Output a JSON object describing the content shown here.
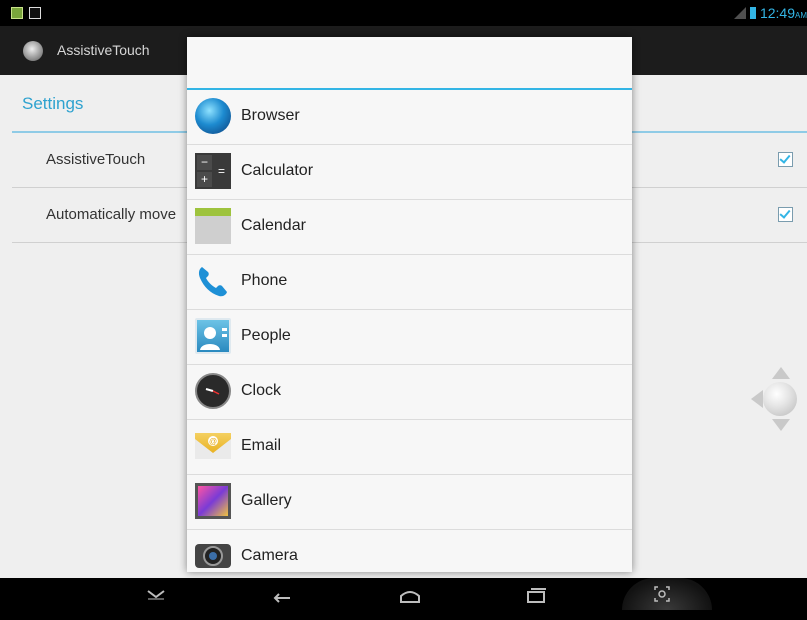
{
  "status_bar": {
    "clock": "12:49",
    "ampm": "AM",
    "icons": [
      "notification-icon",
      "image-icon",
      "signal-icon",
      "battery-icon"
    ],
    "accent": "#33b5e5"
  },
  "app": {
    "title": "AssistiveTouch",
    "section_title": "Settings",
    "rows": [
      {
        "label": "AssistiveTouch",
        "checked": true
      },
      {
        "label": "Automatically move",
        "checked": true
      }
    ]
  },
  "dialog": {
    "title": "",
    "apps": [
      {
        "label": "Browser",
        "icon": "browser-icon"
      },
      {
        "label": "Calculator",
        "icon": "calculator-icon"
      },
      {
        "label": "Calendar",
        "icon": "calendar-icon"
      },
      {
        "label": "Phone",
        "icon": "phone-icon"
      },
      {
        "label": "People",
        "icon": "people-icon"
      },
      {
        "label": "Clock",
        "icon": "clock-icon"
      },
      {
        "label": "Email",
        "icon": "email-icon"
      },
      {
        "label": "Gallery",
        "icon": "gallery-icon"
      },
      {
        "label": "Camera",
        "icon": "camera-icon"
      }
    ]
  },
  "nav_bar": {
    "buttons": [
      "hide-keyboard-icon",
      "back-icon",
      "home-icon",
      "recent-apps-icon",
      "screenshot-icon"
    ]
  }
}
